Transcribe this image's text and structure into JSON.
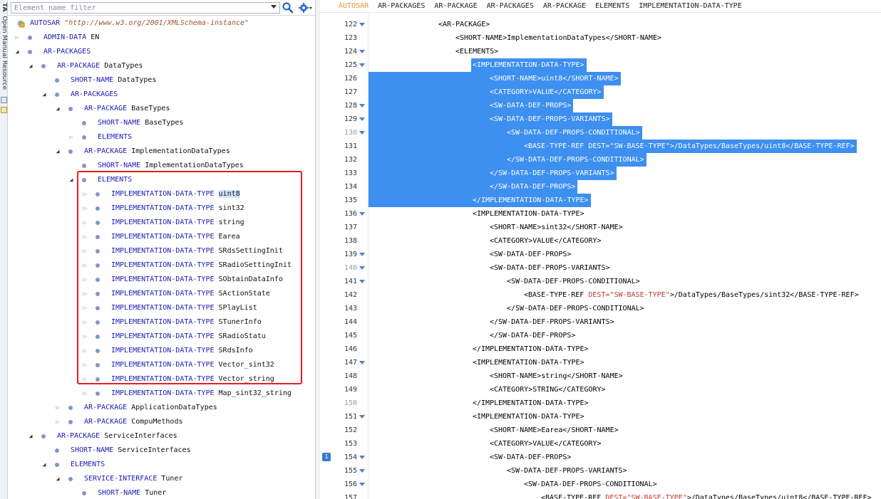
{
  "sidebar_strip": {
    "label": "Open Manual Resource",
    "tab": "TA"
  },
  "filter": {
    "placeholder": "Element name filter"
  },
  "tree": {
    "root": {
      "tag": "AUTOSAR",
      "value": "\"http://www.w3.org/2001/XMLSchema-instance\""
    },
    "rows": [
      {
        "tag": "ADMIN-DATA",
        "value": "EN",
        "level": 1,
        "exp": "closed"
      },
      {
        "tag": "AR-PACKAGES",
        "value": "",
        "level": 1,
        "exp": "open"
      },
      {
        "tag": "AR-PACKAGE",
        "value": "DataTypes",
        "level": 2,
        "exp": "open"
      },
      {
        "tag": "SHORT-NAME",
        "value": "DataTypes",
        "level": 3,
        "exp": "none"
      },
      {
        "tag": "AR-PACKAGES",
        "value": "",
        "level": 3,
        "exp": "open"
      },
      {
        "tag": "AR-PACKAGE",
        "value": "BaseTypes",
        "level": 4,
        "exp": "open"
      },
      {
        "tag": "SHORT-NAME",
        "value": "BaseTypes",
        "level": 5,
        "exp": "none"
      },
      {
        "tag": "ELEMENTS",
        "value": "",
        "level": 5,
        "exp": "closed"
      },
      {
        "tag": "AR-PACKAGE",
        "value": "ImplementationDataTypes",
        "level": 4,
        "exp": "open"
      },
      {
        "tag": "SHORT-NAME",
        "value": "ImplementationDataTypes",
        "level": 5,
        "exp": "none"
      },
      {
        "tag": "ELEMENTS",
        "value": "",
        "level": 5,
        "exp": "open"
      },
      {
        "tag": "IMPLEMENTATION-DATA-TYPE",
        "value": "uint8",
        "level": 6,
        "exp": "closed",
        "selected": true
      },
      {
        "tag": "IMPLEMENTATION-DATA-TYPE",
        "value": "sint32",
        "level": 6,
        "exp": "closed"
      },
      {
        "tag": "IMPLEMENTATION-DATA-TYPE",
        "value": "string",
        "level": 6,
        "exp": "closed"
      },
      {
        "tag": "IMPLEMENTATION-DATA-TYPE",
        "value": "Earea",
        "level": 6,
        "exp": "closed"
      },
      {
        "tag": "IMPLEMENTATION-DATA-TYPE",
        "value": "SRdsSettingInit",
        "level": 6,
        "exp": "closed"
      },
      {
        "tag": "IMPLEMENTATION-DATA-TYPE",
        "value": "SRadioSettingInit",
        "level": 6,
        "exp": "closed"
      },
      {
        "tag": "IMPLEMENTATION-DATA-TYPE",
        "value": "SObtainDataInfo",
        "level": 6,
        "exp": "closed"
      },
      {
        "tag": "IMPLEMENTATION-DATA-TYPE",
        "value": "SActionState",
        "level": 6,
        "exp": "closed"
      },
      {
        "tag": "IMPLEMENTATION-DATA-TYPE",
        "value": "SPlayList",
        "level": 6,
        "exp": "closed"
      },
      {
        "tag": "IMPLEMENTATION-DATA-TYPE",
        "value": "STunerInfo",
        "level": 6,
        "exp": "closed"
      },
      {
        "tag": "IMPLEMENTATION-DATA-TYPE",
        "value": "SRadioStatu",
        "level": 6,
        "exp": "closed"
      },
      {
        "tag": "IMPLEMENTATION-DATA-TYPE",
        "value": "SRdsInfo",
        "level": 6,
        "exp": "closed"
      },
      {
        "tag": "IMPLEMENTATION-DATA-TYPE",
        "value": "Vector_sint32",
        "level": 6,
        "exp": "closed"
      },
      {
        "tag": "IMPLEMENTATION-DATA-TYPE",
        "value": "Vector_string",
        "level": 6,
        "exp": "closed"
      },
      {
        "tag": "IMPLEMENTATION-DATA-TYPE",
        "value": "Map_sint32_string",
        "level": 6,
        "exp": "closed"
      },
      {
        "tag": "AR-PACKAGE",
        "value": "ApplicationDataTypes",
        "level": 4,
        "exp": "closed"
      },
      {
        "tag": "AR-PACKAGE",
        "value": "CompuMethods",
        "level": 4,
        "exp": "closed"
      },
      {
        "tag": "AR-PACKAGE",
        "value": "ServiceInterfaces",
        "level": 2,
        "exp": "open"
      },
      {
        "tag": "SHORT-NAME",
        "value": "ServiceInterfaces",
        "level": 3,
        "exp": "none"
      },
      {
        "tag": "ELEMENTS",
        "value": "",
        "level": 3,
        "exp": "open"
      },
      {
        "tag": "SERVICE-INTERFACE",
        "value": "Tuner",
        "level": 4,
        "exp": "open"
      },
      {
        "tag": "SHORT-NAME",
        "value": "Tuner",
        "level": 5,
        "exp": "none"
      }
    ]
  },
  "breadcrumb": [
    "AUTOSAR",
    "AR-PACKAGES",
    "AR-PACKAGE",
    "AR-PACKAGES",
    "AR-PACKAGE",
    "ELEMENTS",
    "IMPLEMENTATION-DATA-TYPE"
  ],
  "editor": {
    "marker": "1",
    "lines": [
      {
        "n": "122",
        "fold": true,
        "indent": 0,
        "text": "<AR-PACKAGE>"
      },
      {
        "n": "123",
        "fold": false,
        "indent": 1,
        "text": "<SHORT-NAME>ImplementationDataTypes</SHORT-NAME>"
      },
      {
        "n": "124",
        "fold": true,
        "indent": 1,
        "text": "<ELEMENTS>"
      },
      {
        "n": "125",
        "fold": true,
        "indent": 2,
        "text": "<IMPLEMENTATION-DATA-TYPE>",
        "sel": "partial"
      },
      {
        "n": "126",
        "fold": false,
        "indent": 3,
        "text": "<SHORT-NAME>uint8</SHORT-NAME>",
        "sel": "full"
      },
      {
        "n": "127",
        "fold": false,
        "indent": 3,
        "text": "<CATEGORY>VALUE</CATEGORY>",
        "sel": "full"
      },
      {
        "n": "128",
        "fold": true,
        "indent": 3,
        "text": "<SW-DATA-DEF-PROPS>",
        "sel": "full"
      },
      {
        "n": "129",
        "fold": true,
        "indent": 3,
        "text": "<SW-DATA-DEF-PROPS-VARIANTS>",
        "sel": "full"
      },
      {
        "n": "130",
        "fold": true,
        "dim": true,
        "indent": 4,
        "text": "<SW-DATA-DEF-PROPS-CONDITIONAL>",
        "sel": "full"
      },
      {
        "n": "131",
        "fold": false,
        "indent": 5,
        "pre": "<BASE-TYPE-REF ",
        "attr": "DEST=",
        "str": "\"SW-BASE-TYPE\"",
        "post": ">/DataTypes/BaseTypes/uint8</BASE-TYPE-REF>",
        "sel": "full"
      },
      {
        "n": "132",
        "fold": false,
        "indent": 4,
        "text": "</SW-DATA-DEF-PROPS-CONDITIONAL>",
        "sel": "full"
      },
      {
        "n": "133",
        "fold": false,
        "indent": 3,
        "text": "</SW-DATA-DEF-PROPS-VARIANTS>",
        "sel": "full"
      },
      {
        "n": "134",
        "fold": false,
        "indent": 3,
        "text": "</SW-DATA-DEF-PROPS>",
        "sel": "full"
      },
      {
        "n": "135",
        "fold": false,
        "indent": 2,
        "text": "</IMPLEMENTATION-DATA-TYPE>",
        "sel": "full"
      },
      {
        "n": "136",
        "fold": true,
        "indent": 2,
        "text": "<IMPLEMENTATION-DATA-TYPE>"
      },
      {
        "n": "137",
        "fold": false,
        "indent": 3,
        "text": "<SHORT-NAME>sint32</SHORT-NAME>"
      },
      {
        "n": "138",
        "fold": false,
        "indent": 3,
        "text": "<CATEGORY>VALUE</CATEGORY>"
      },
      {
        "n": "139",
        "fold": true,
        "indent": 3,
        "text": "<SW-DATA-DEF-PROPS>"
      },
      {
        "n": "140",
        "fold": true,
        "dim": true,
        "indent": 3,
        "text": "<SW-DATA-DEF-PROPS-VARIANTS>"
      },
      {
        "n": "141",
        "fold": true,
        "indent": 4,
        "text": "<SW-DATA-DEF-PROPS-CONDITIONAL>"
      },
      {
        "n": "142",
        "fold": false,
        "indent": 5,
        "pre": "<BASE-TYPE-REF ",
        "attr": "DEST=",
        "str": "\"SW-BASE-TYPE\"",
        "post": ">/DataTypes/BaseTypes/sint32</BASE-TYPE-REF>"
      },
      {
        "n": "143",
        "fold": false,
        "indent": 4,
        "text": "</SW-DATA-DEF-PROPS-CONDITIONAL>"
      },
      {
        "n": "144",
        "fold": false,
        "indent": 3,
        "text": "</SW-DATA-DEF-PROPS-VARIANTS>"
      },
      {
        "n": "145",
        "fold": false,
        "indent": 3,
        "text": "</SW-DATA-DEF-PROPS>"
      },
      {
        "n": "146",
        "fold": false,
        "indent": 2,
        "text": "</IMPLEMENTATION-DATA-TYPE>"
      },
      {
        "n": "147",
        "fold": true,
        "indent": 2,
        "text": "<IMPLEMENTATION-DATA-TYPE>"
      },
      {
        "n": "148",
        "fold": false,
        "indent": 3,
        "text": "<SHORT-NAME>string</SHORT-NAME>"
      },
      {
        "n": "149",
        "fold": false,
        "indent": 3,
        "text": "<CATEGORY>STRING</CATEGORY>"
      },
      {
        "n": "150",
        "fold": false,
        "dim": true,
        "indent": 2,
        "text": "</IMPLEMENTATION-DATA-TYPE>"
      },
      {
        "n": "151",
        "fold": true,
        "indent": 2,
        "text": "<IMPLEMENTATION-DATA-TYPE>"
      },
      {
        "n": "152",
        "fold": false,
        "indent": 3,
        "text": "<SHORT-NAME>Earea</SHORT-NAME>"
      },
      {
        "n": "153",
        "fold": false,
        "indent": 3,
        "text": "<CATEGORY>VALUE</CATEGORY>"
      },
      {
        "n": "154",
        "fold": true,
        "indent": 3,
        "text": "<SW-DATA-DEF-PROPS>"
      },
      {
        "n": "155",
        "fold": true,
        "indent": 4,
        "text": "<SW-DATA-DEF-PROPS-VARIANTS>"
      },
      {
        "n": "156",
        "fold": true,
        "indent": 5,
        "text": "<SW-DATA-DEF-PROPS-CONDITIONAL>"
      },
      {
        "n": "157",
        "fold": false,
        "indent": 6,
        "pre": "<BASE-TYPE-REF ",
        "attr": "DEST=",
        "str": "\"SW-BASE-TYPE\"",
        "post": ">/DataTypes/BaseTypes/uint8</BASE-TYPE-REF>"
      }
    ]
  }
}
